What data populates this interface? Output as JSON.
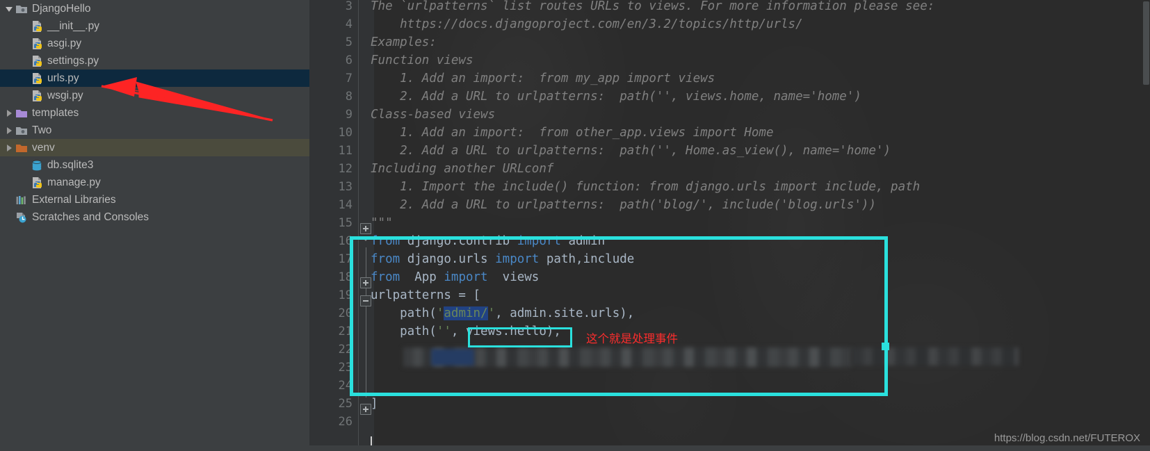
{
  "sidebar": {
    "name": "project-tree",
    "items": [
      {
        "label": "DjangoHello",
        "icon": "folder-module-icon",
        "indent": 0,
        "arrow": "down",
        "state": "normal"
      },
      {
        "label": "__init__.py",
        "icon": "python-file-icon",
        "indent": 1,
        "arrow": "none",
        "state": "normal"
      },
      {
        "label": "asgi.py",
        "icon": "python-file-icon",
        "indent": 1,
        "arrow": "none",
        "state": "normal"
      },
      {
        "label": "settings.py",
        "icon": "python-file-icon",
        "indent": 1,
        "arrow": "none",
        "state": "normal"
      },
      {
        "label": "urls.py",
        "icon": "python-file-icon",
        "indent": 1,
        "arrow": "none",
        "state": "selected"
      },
      {
        "label": "wsgi.py",
        "icon": "python-file-icon",
        "indent": 1,
        "arrow": "none",
        "state": "normal"
      },
      {
        "label": "templates",
        "icon": "folder-purple-icon",
        "indent": 0,
        "arrow": "right",
        "state": "normal"
      },
      {
        "label": "Two",
        "icon": "folder-module-icon",
        "indent": 0,
        "arrow": "right",
        "state": "normal"
      },
      {
        "label": "venv",
        "icon": "folder-orange-icon",
        "indent": 0,
        "arrow": "right",
        "state": "highlighted"
      },
      {
        "label": "db.sqlite3",
        "icon": "database-icon",
        "indent": 1,
        "arrow": "none",
        "state": "normal"
      },
      {
        "label": "manage.py",
        "icon": "python-file-icon",
        "indent": 1,
        "arrow": "none",
        "state": "normal"
      },
      {
        "label": "External Libraries",
        "icon": "libraries-icon",
        "indent": 0,
        "arrow": "none",
        "state": "normal"
      },
      {
        "label": "Scratches and Consoles",
        "icon": "scratches-icon",
        "indent": 0,
        "arrow": "none",
        "state": "normal"
      }
    ]
  },
  "editor": {
    "name": "code-editor-urls-py",
    "first_visible_line": 3,
    "lines": [
      {
        "no": "3",
        "text": "The `urlpatterns` list routes URLs to views. For more information please see:",
        "kind": "docstring",
        "indent": 0
      },
      {
        "no": "4",
        "text": "    https://docs.djangoproject.com/en/3.2/topics/http/urls/",
        "kind": "docstring",
        "indent": 0
      },
      {
        "no": "5",
        "text": "Examples:",
        "kind": "docstring",
        "indent": 0
      },
      {
        "no": "6",
        "text": "Function views",
        "kind": "docstring",
        "indent": 0
      },
      {
        "no": "7",
        "text": "    1. Add an import:  from my_app import views",
        "kind": "docstring",
        "indent": 0
      },
      {
        "no": "8",
        "text": "    2. Add a URL to urlpatterns:  path('', views.home, name='home')",
        "kind": "docstring",
        "indent": 0
      },
      {
        "no": "9",
        "text": "Class-based views",
        "kind": "docstring",
        "indent": 0
      },
      {
        "no": "10",
        "text": "    1. Add an import:  from other_app.views import Home",
        "kind": "docstring",
        "indent": 0
      },
      {
        "no": "11",
        "text": "    2. Add a URL to urlpatterns:  path('', Home.as_view(), name='home')",
        "kind": "docstring",
        "indent": 0
      },
      {
        "no": "12",
        "text": "Including another URLconf",
        "kind": "docstring",
        "indent": 0
      },
      {
        "no": "13",
        "text": "    1. Import the include() function: from django.urls import include, path",
        "kind": "docstring",
        "indent": 0
      },
      {
        "no": "14",
        "text": "    2. Add a URL to urlpatterns:  path('blog/', include('blog.urls'))",
        "kind": "docstring",
        "indent": 0
      },
      {
        "no": "15",
        "text": "\"\"\"",
        "kind": "docstring-end",
        "indent": 0
      },
      {
        "no": "16",
        "text": "from django.contrib import admin",
        "kind": "code",
        "indent": 0
      },
      {
        "no": "17",
        "text": "from django.urls import path,include",
        "kind": "code",
        "indent": 0
      },
      {
        "no": "18",
        "text": "from  App import  views",
        "kind": "code",
        "indent": 0
      },
      {
        "no": "19",
        "text": "urlpatterns = [",
        "kind": "code",
        "indent": 0
      },
      {
        "no": "20",
        "text": "    path('admin/', admin.site.urls),",
        "kind": "code",
        "indent": 0
      },
      {
        "no": "21",
        "text": "    path('', views.hello),",
        "kind": "code",
        "indent": 0
      },
      {
        "no": "22",
        "text": "",
        "kind": "censored",
        "indent": 0
      },
      {
        "no": "23",
        "text": "",
        "kind": "code",
        "indent": 0
      },
      {
        "no": "24",
        "text": "",
        "kind": "code",
        "indent": 0
      },
      {
        "no": "25",
        "text": "]",
        "kind": "code",
        "indent": 0
      },
      {
        "no": "26",
        "text": "",
        "kind": "code",
        "indent": 0
      }
    ],
    "tokens": {
      "l16": [
        {
          "t": "from",
          "c": "kw"
        },
        {
          "t": " django.contrib ",
          "c": "id"
        },
        {
          "t": "import",
          "c": "kw"
        },
        {
          "t": " admin",
          "c": "id"
        }
      ],
      "l17": [
        {
          "t": "from",
          "c": "kw"
        },
        {
          "t": " django.urls ",
          "c": "id"
        },
        {
          "t": "import",
          "c": "kw"
        },
        {
          "t": " path,include",
          "c": "id"
        }
      ],
      "l18": [
        {
          "t": "from",
          "c": "kw"
        },
        {
          "t": "  App ",
          "c": "id"
        },
        {
          "t": "import",
          "c": "kw"
        },
        {
          "t": "  views",
          "c": "id"
        }
      ],
      "l19": [
        {
          "t": "urlpatterns = [",
          "c": "id"
        }
      ],
      "l20": [
        {
          "t": "    path(",
          "c": "id"
        },
        {
          "t": "'",
          "c": "str"
        },
        {
          "t": "admin/",
          "c": "str sel"
        },
        {
          "t": "'",
          "c": "str"
        },
        {
          "t": ", admin.site.urls),",
          "c": "id"
        }
      ],
      "l21": [
        {
          "t": "    path(",
          "c": "id"
        },
        {
          "t": "''",
          "c": "str"
        },
        {
          "t": ", views.hello),",
          "c": "id"
        }
      ],
      "l25": [
        {
          "t": "]",
          "c": "id"
        }
      ]
    }
  },
  "annotations": {
    "big_box_name": "cyan-highlight-box",
    "small_box_name": "cyan-highlight-views-hello",
    "note_text": "这个就是处理事件",
    "note_color": "#fb2d2d",
    "box_color": "#2ae0dd",
    "arrow_color": "#fd2424",
    "arrow_target": "urls.py",
    "censored_line": "22"
  },
  "watermark": {
    "text": "https://blog.csdn.net/FUTEROX"
  },
  "colors": {
    "sidebar_bg": "#3c3f41",
    "editor_bg": "#2b2b2b",
    "gutter_bg": "#313335",
    "selection_row": "#0d293e",
    "venv_row": "#4b4b3d",
    "keyword": "#4a88c7",
    "identifier": "#a9b7c6",
    "string": "#6a8759",
    "docstring": "#808080",
    "lineno": "#707476"
  }
}
